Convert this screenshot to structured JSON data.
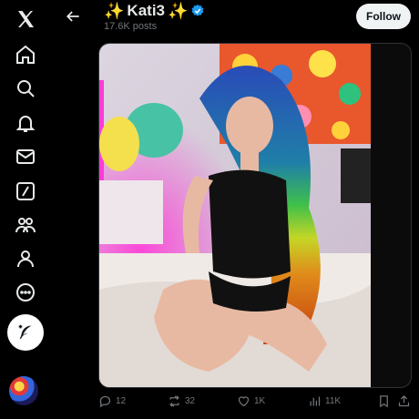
{
  "header": {
    "title": "Kati3",
    "sparkle_left": "✨",
    "sparkle_right": "✨",
    "post_count": "17.6K posts",
    "follow_label": "Follow"
  },
  "nav": {
    "items": [
      "x-logo-icon",
      "home-icon",
      "search-icon",
      "notifications-icon",
      "messages-icon",
      "grok-icon",
      "communities-icon",
      "profile-icon",
      "more-icon"
    ],
    "compose_icon": "compose-post-icon"
  },
  "actions": {
    "replies": "12",
    "reposts": "32",
    "likes": "1K",
    "views": "11K"
  },
  "colors": {
    "background": "#000000",
    "text": "#e7e9ea",
    "muted": "#71767b",
    "verified": "#1d9bf0",
    "follow_bg": "#eff3f4"
  }
}
